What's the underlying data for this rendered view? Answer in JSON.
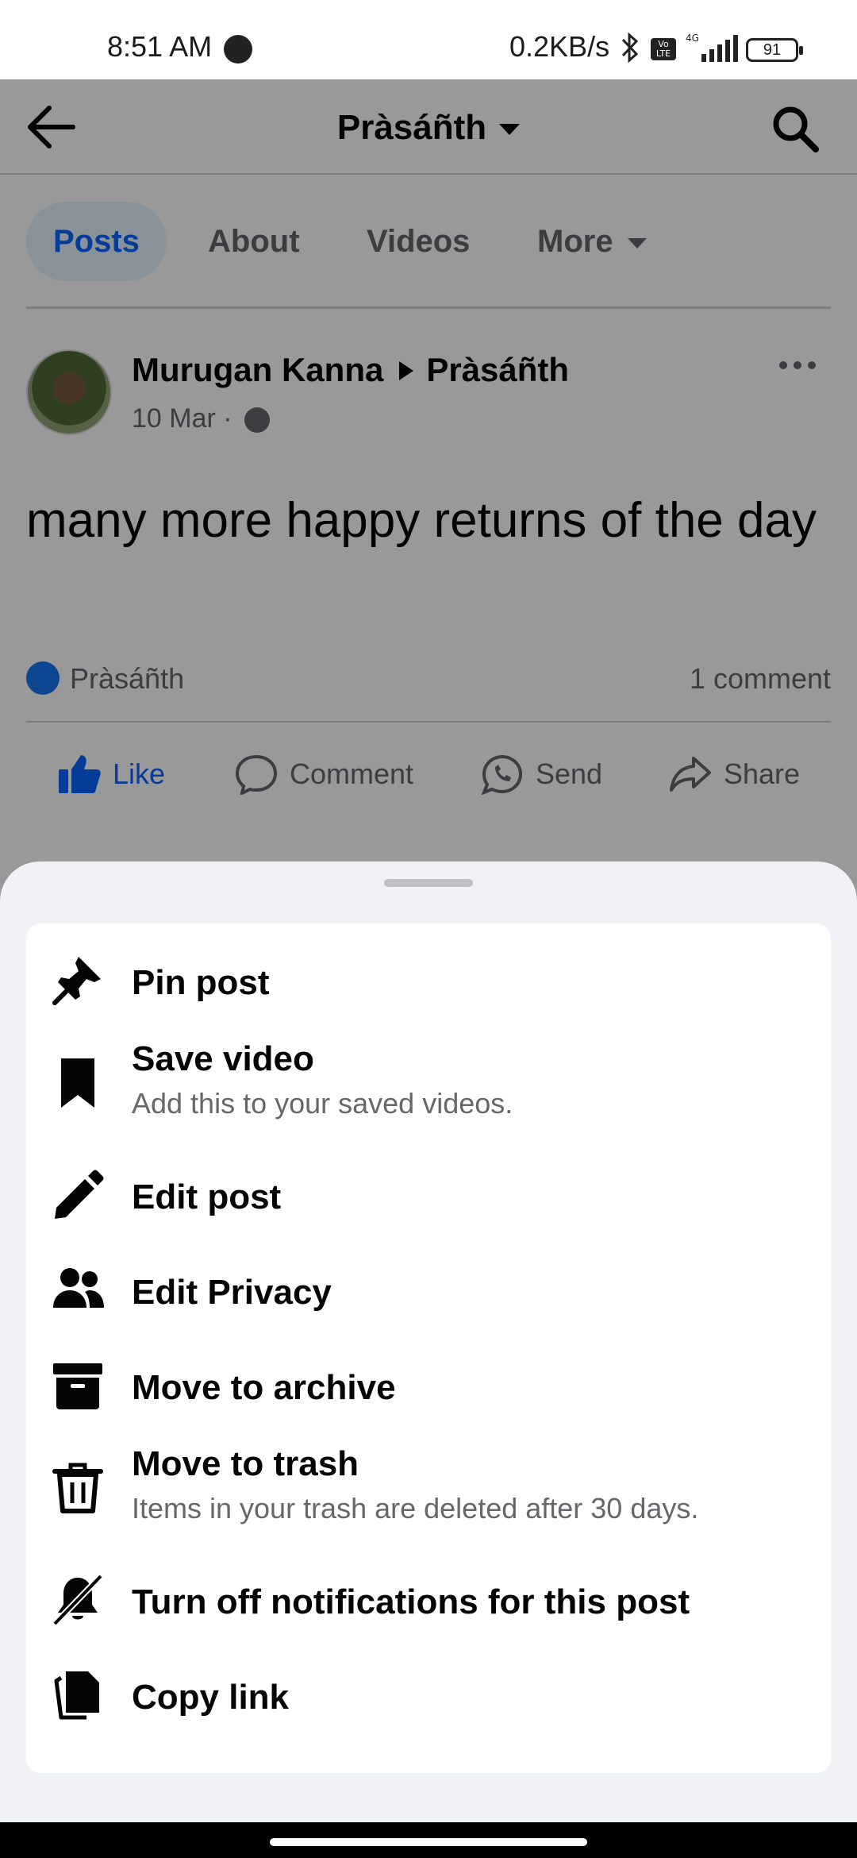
{
  "status_bar": {
    "time": "8:51 AM",
    "net_speed": "0.2KB/s",
    "network": "4G",
    "volte": "Vo LTE",
    "battery": "91"
  },
  "header": {
    "title": "Pràsáñth",
    "icons": {
      "back": "arrow-left-icon",
      "search": "search-icon"
    }
  },
  "tabs": [
    {
      "label": "Posts",
      "active": true
    },
    {
      "label": "About"
    },
    {
      "label": "Videos"
    },
    {
      "label": "More"
    }
  ],
  "post": {
    "author": "Murugan Kanna",
    "target": "Pràsáñth",
    "date": "10 Mar ·",
    "text": "many more happy returns of the day",
    "reaction_by": "Pràsáñth",
    "comment_count": "1 comment",
    "actions": {
      "like": "Like",
      "comment": "Comment",
      "send": "Send",
      "share": "Share"
    }
  },
  "sheet": {
    "items": [
      {
        "label": "Pin post",
        "icon": "pin-icon"
      },
      {
        "label": "Save video",
        "sub": "Add this to your saved videos.",
        "icon": "bookmark-icon"
      },
      {
        "label": "Edit post",
        "icon": "pencil-icon"
      },
      {
        "label": "Edit Privacy",
        "icon": "people-icon"
      },
      {
        "label": "Move to archive",
        "icon": "archive-icon"
      },
      {
        "label": "Move to trash",
        "sub": "Items in your trash are deleted after 30 days.",
        "icon": "trash-icon"
      },
      {
        "label": "Turn off notifications for this post",
        "icon": "bell-off-icon"
      },
      {
        "label": "Copy link",
        "icon": "copy-icon"
      }
    ]
  },
  "colors": {
    "accent": "#0866ff",
    "secondary_text": "#65676b",
    "sheet_bg": "#f0f2f5"
  }
}
